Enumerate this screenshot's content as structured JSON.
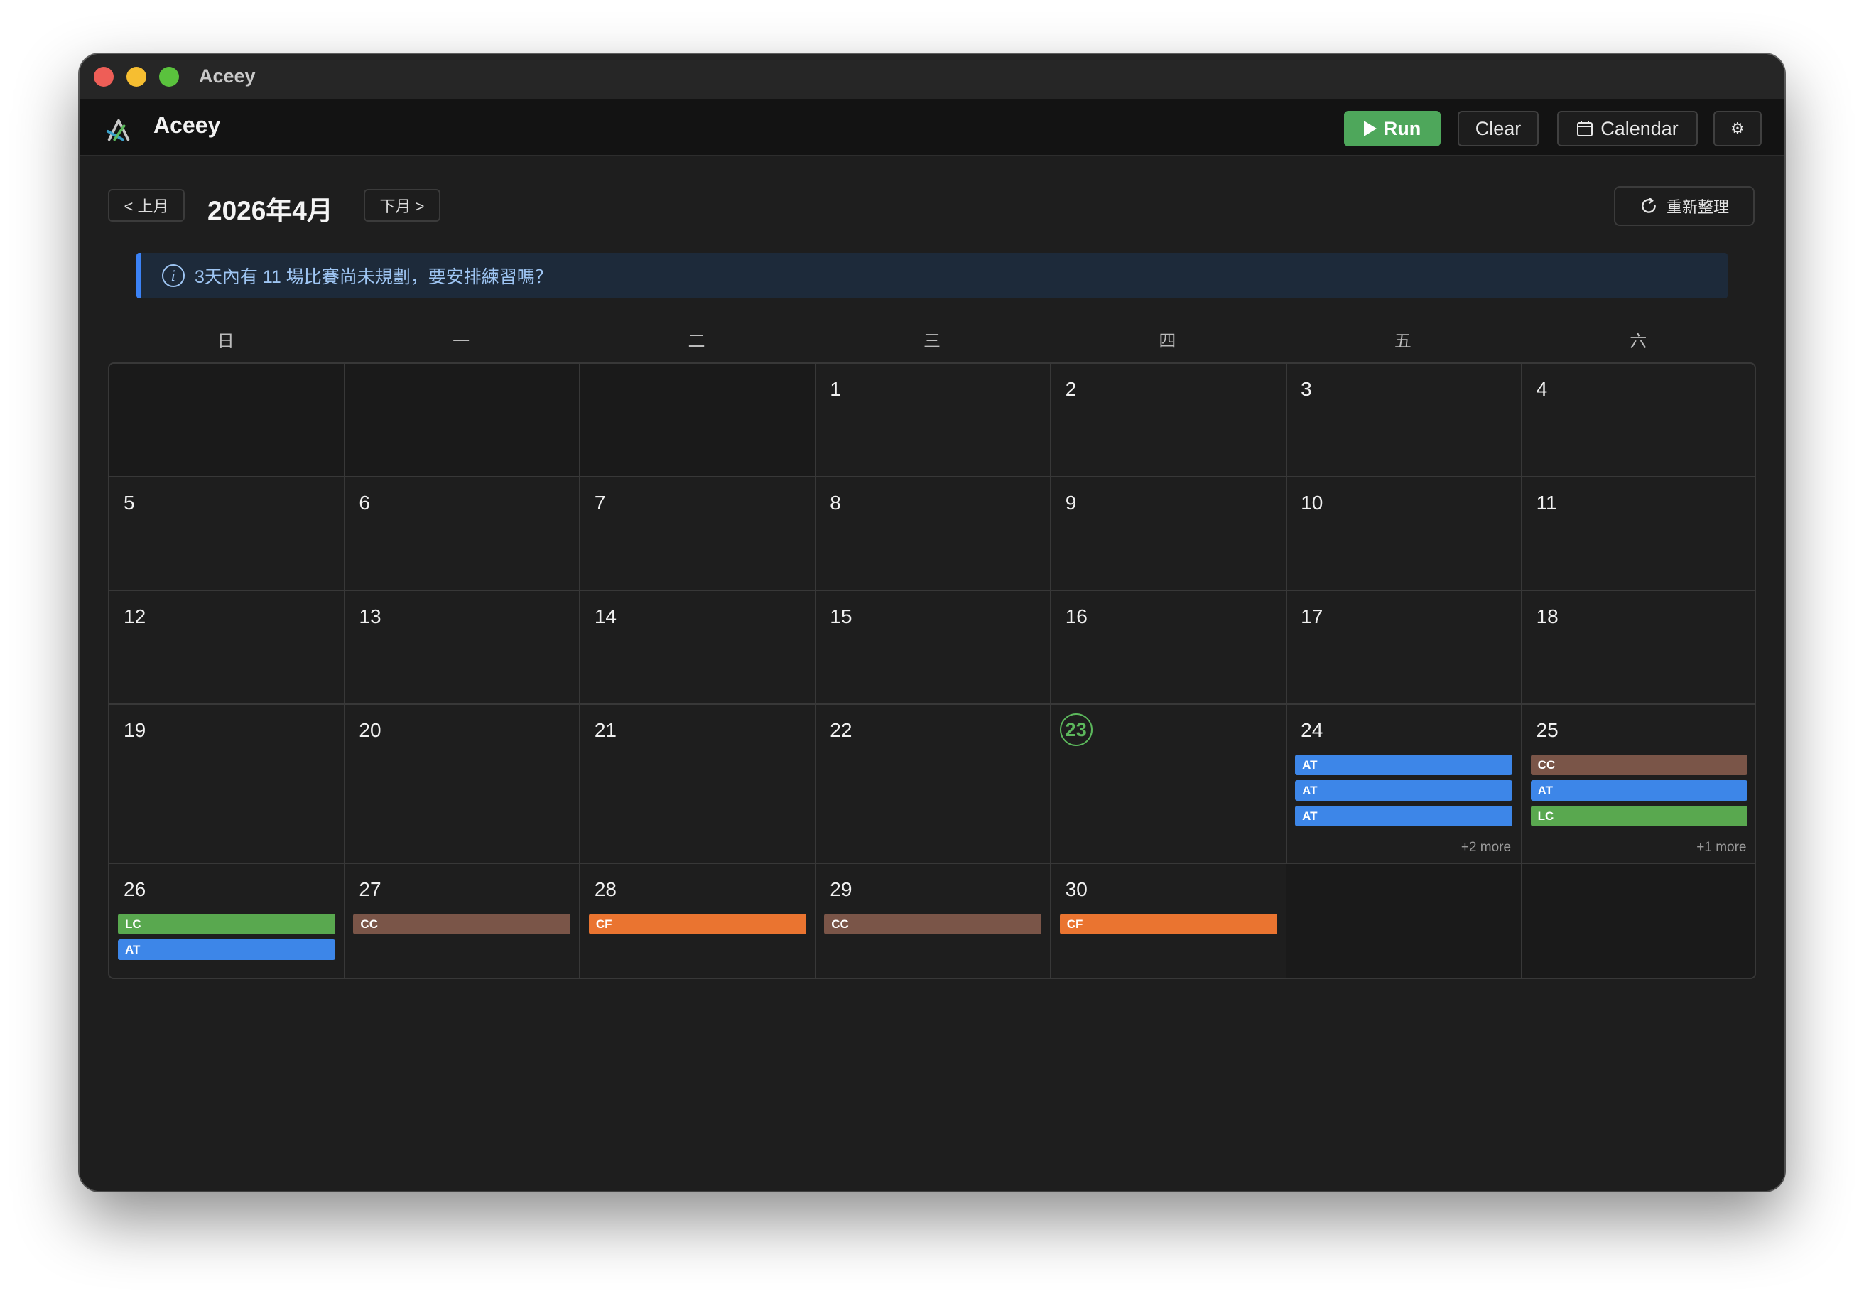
{
  "window": {
    "title": "Aceey"
  },
  "app": {
    "name": "Aceey"
  },
  "toolbar": {
    "run_label": "Run",
    "clear_label": "Clear",
    "calendar_label": "Calendar",
    "settings_label": "⚙"
  },
  "calendar": {
    "prev_label": "< 上月",
    "next_label": "下月 >",
    "month_title": "2026年4月",
    "refresh_label": "重新整理",
    "banner_text": "3天內有 11 場比賽尚未規劃，要安排練習嗎？",
    "weekdays": [
      "日",
      "一",
      "二",
      "三",
      "四",
      "五",
      "六"
    ],
    "today": 23,
    "weeks": [
      [
        null,
        null,
        null,
        {
          "day": 1,
          "events": []
        },
        {
          "day": 2,
          "events": []
        },
        {
          "day": 3,
          "events": []
        },
        {
          "day": 4,
          "events": []
        }
      ],
      [
        {
          "day": 5,
          "events": []
        },
        {
          "day": 6,
          "events": []
        },
        {
          "day": 7,
          "events": []
        },
        {
          "day": 8,
          "events": []
        },
        {
          "day": 9,
          "events": []
        },
        {
          "day": 10,
          "events": []
        },
        {
          "day": 11,
          "events": []
        }
      ],
      [
        {
          "day": 12,
          "events": []
        },
        {
          "day": 13,
          "events": []
        },
        {
          "day": 14,
          "events": []
        },
        {
          "day": 15,
          "events": []
        },
        {
          "day": 16,
          "events": []
        },
        {
          "day": 17,
          "events": []
        },
        {
          "day": 18,
          "events": []
        }
      ],
      [
        {
          "day": 19,
          "events": []
        },
        {
          "day": 20,
          "events": []
        },
        {
          "day": 21,
          "events": []
        },
        {
          "day": 22,
          "events": []
        },
        {
          "day": 23,
          "events": []
        },
        {
          "day": 24,
          "events": [
            "AT",
            "AT",
            "AT"
          ],
          "more": "+2 more"
        },
        {
          "day": 25,
          "events": [
            "CC",
            "AT",
            "LC"
          ],
          "more": "+1 more"
        }
      ],
      [
        {
          "day": 26,
          "events": [
            "LC",
            "AT"
          ]
        },
        {
          "day": 27,
          "events": [
            "CC"
          ]
        },
        {
          "day": 28,
          "events": [
            "CF"
          ]
        },
        {
          "day": 29,
          "events": [
            "CC"
          ]
        },
        {
          "day": 30,
          "events": [
            "CF"
          ]
        },
        null,
        null
      ]
    ],
    "event_colors": {
      "AT": "#3d86e8",
      "CC": "#7a5548",
      "LC": "#59a84f",
      "CF": "#ea7430"
    }
  }
}
